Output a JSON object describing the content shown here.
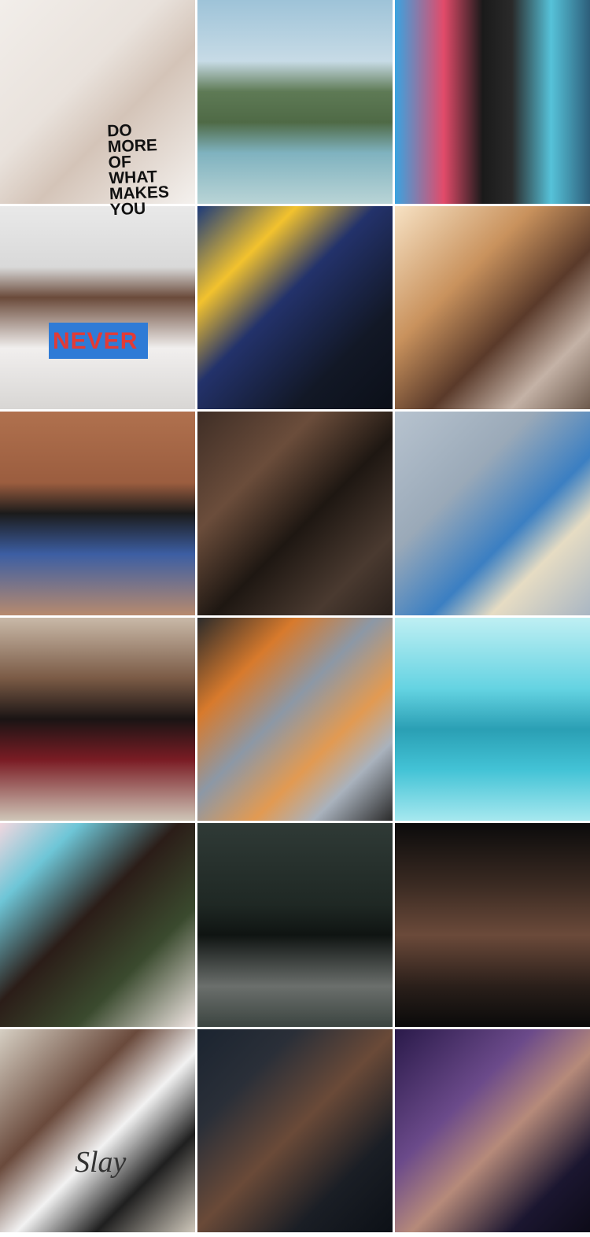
{
  "grid": {
    "columns": 3,
    "rows": 6
  },
  "tiles": [
    {
      "name": "flatlay-coffee-quote",
      "gradient": "linear-gradient(135deg,#f2eeea 0%,#e9e2dc 40%,#d4c4b8 60%,#f4f1ee 100%)"
    },
    {
      "name": "island-longtail-boat",
      "gradient": "linear-gradient(180deg,#9ec3d8 0%,#c7dbe6 30%,#5e7a55 45%,#4f6a46 60%,#7fb2bf 75%,#b9d4d6 100%)"
    },
    {
      "name": "woman-black-hat-graffiti",
      "gradient": "linear-gradient(90deg,#3aa3e0 0%,#e24b6a 25%,#1a1a1a 45%,#2a2a2a 60%,#56c2d9 80%,#2d5e7a 100%)"
    },
    {
      "name": "curly-hair-never-shirt",
      "gradient": "linear-gradient(180deg,#e9e9e9 0%,#d9d9d9 30%,#6a4a3a 45%,#f1efee 70%,#d8d6d4 100%)"
    },
    {
      "name": "woman-round-glasses-sign",
      "gradient": "linear-gradient(135deg,#1c3a7a 0%,#f2c22e 25%,#23326b 45%,#121826 75%,#0b0f18 100%)"
    },
    {
      "name": "woman-red-afro-sunlight",
      "gradient": "linear-gradient(135deg,#f7e2c4 0%,#c9925d 35%,#5a3a2a 60%,#c4b2a6 80%,#6d5a4d 100%)"
    },
    {
      "name": "woman-sitting-sun-fence",
      "gradient": "linear-gradient(180deg,#b0714e 0%,#9b5d3f 35%,#1b1b1b 50%,#3c5ea3 70%,#b78a6e 100%)"
    },
    {
      "name": "two-women-smiling",
      "gradient": "linear-gradient(135deg,#3f2e26 0%,#6b4d3b 30%,#1e1712 55%,#4a3a30 80%,#2a211c 100%)"
    },
    {
      "name": "man-hat-phone-overhead",
      "gradient": "linear-gradient(135deg,#b7c3cf 0%,#9aa9b8 35%,#3b7fc2 60%,#e6dcc3 75%,#a9b6c3 100%)"
    },
    {
      "name": "group-women-couch",
      "gradient": "linear-gradient(180deg,#c9b9a8 0%,#7a5a45 30%,#1a1414 50%,#7a1c24 70%,#cfc6b8 100%)"
    },
    {
      "name": "macarons-tray",
      "gradient": "linear-gradient(135deg,#2b2b2b 0%,#d87a2c 25%,#8c98a6 45%,#e29a52 65%,#a9b2bd 80%,#2a2a2a 100%)"
    },
    {
      "name": "woman-underwater-cyan",
      "gradient": "linear-gradient(180deg,#bfeff3 0%,#64d3e2 35%,#2a9fb4 55%,#43c3d6 75%,#a6e8ef 100%)"
    },
    {
      "name": "mother-kissing-child",
      "gradient": "linear-gradient(135deg,#f1d7df 0%,#6ec6d7 20%,#2b1d18 45%,#3a4a2e 70%,#f1e7e4 100%)"
    },
    {
      "name": "woman-afro-grey-sweater",
      "gradient": "linear-gradient(180deg,#2f3a36 0%,#1f2824 40%,#0f1412 55%,#6b6f6c 80%,#3c4541 100%)"
    },
    {
      "name": "tattooed-man-skateboard",
      "gradient": "linear-gradient(180deg,#0b0b0b 0%,#3a2a22 30%,#6b4a3a 55%,#2a1f1a 80%,#0a0a0a 100%)"
    },
    {
      "name": "woman-slay-shirt-bars",
      "gradient": "linear-gradient(135deg,#d6cfc3 0%,#6a4a3c 35%,#f2f2f2 55%,#1f1f1f 75%,#cfc8bb 100%)"
    },
    {
      "name": "woman-laughing-dark",
      "gradient": "linear-gradient(135deg,#1b2430 0%,#2a2f38 25%,#6a4a38 50%,#1a1e25 75%,#0c1016 100%)"
    },
    {
      "name": "woman-sunglasses-purple",
      "gradient": "linear-gradient(135deg,#2a1a4a 0%,#6b4a8a 35%,#b68a7a 55%,#1b1630 80%,#0d0b18 100%)"
    }
  ],
  "texts": {
    "quote": "DO\nMORE\nOF\nWHAT\nMAKES\nYOU",
    "shirt": "NEVER",
    "slay": "Slay"
  }
}
